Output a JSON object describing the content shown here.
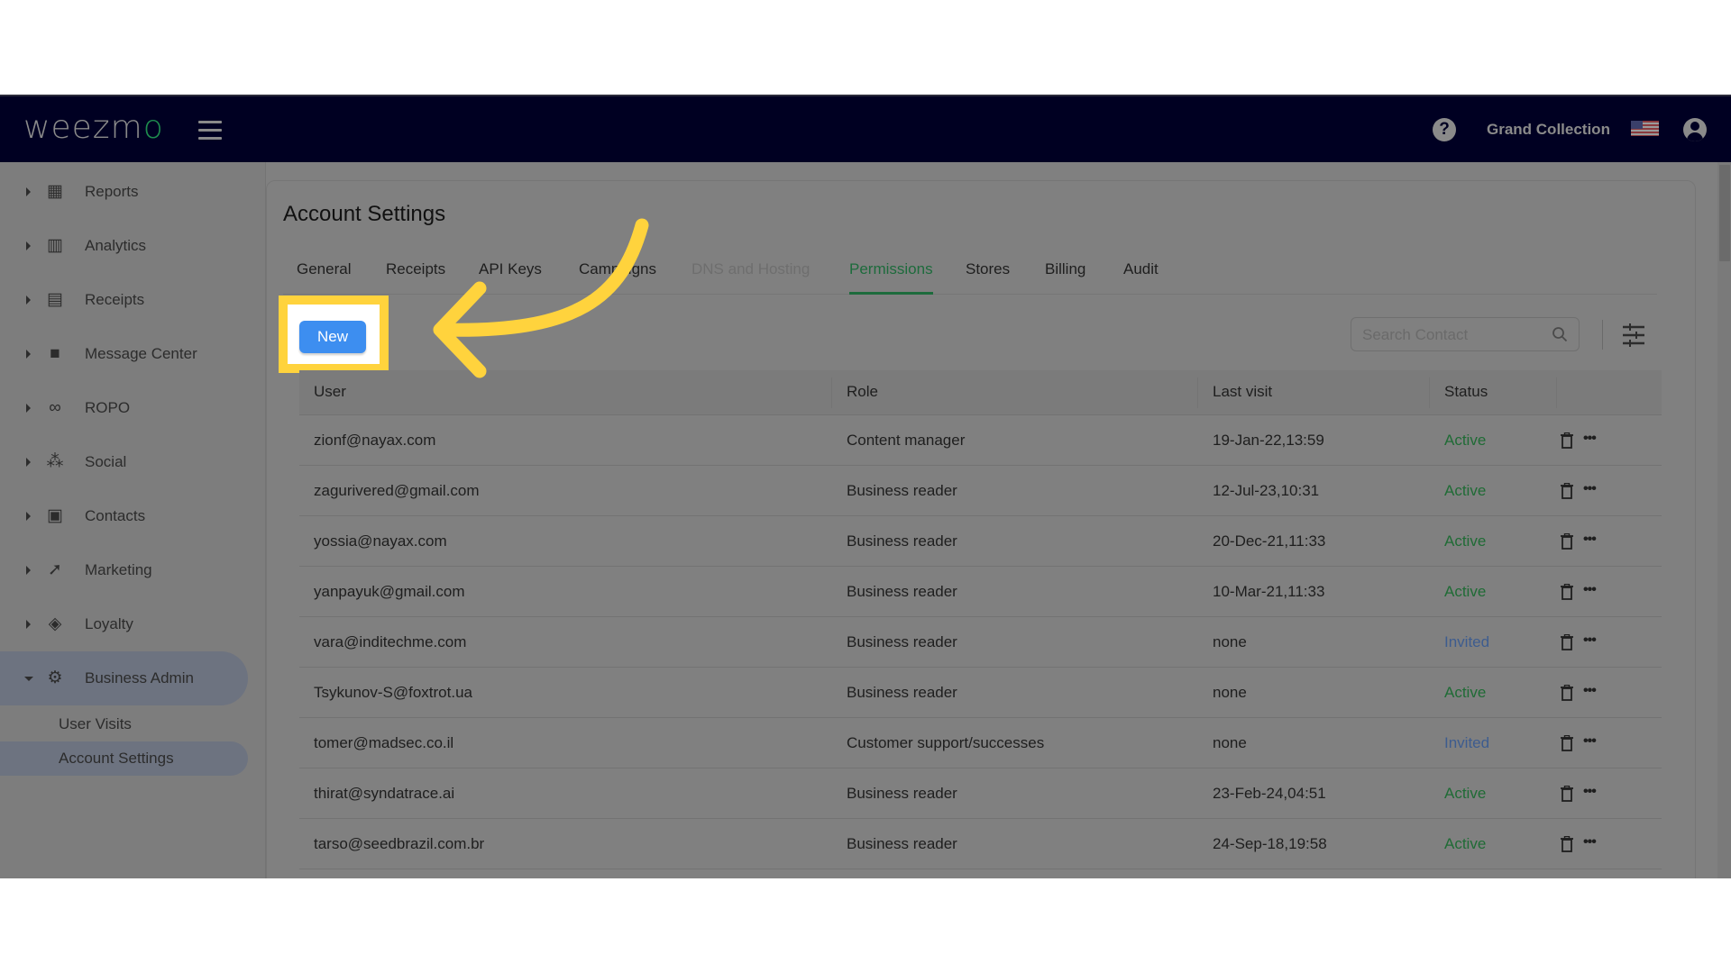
{
  "header": {
    "logo": "weezm",
    "logo_accent": "o",
    "account_name": "Grand Collection",
    "icons": [
      "menu-icon",
      "help-icon",
      "us-flag-icon",
      "user-account-icon"
    ]
  },
  "sidebar": {
    "items": [
      {
        "label": "Reports",
        "icon": "dashboard-icon",
        "glyph": "▦"
      },
      {
        "label": "Analytics",
        "icon": "bar-chart-icon",
        "glyph": "▥"
      },
      {
        "label": "Receipts",
        "icon": "receipt-icon",
        "glyph": "▤"
      },
      {
        "label": "Message Center",
        "icon": "chat-bubble-icon",
        "glyph": "■"
      },
      {
        "label": "ROPO",
        "icon": "infinity-icon",
        "glyph": "∞"
      },
      {
        "label": "Social",
        "icon": "people-group-icon",
        "glyph": "⁂"
      },
      {
        "label": "Contacts",
        "icon": "contact-card-icon",
        "glyph": "▣"
      },
      {
        "label": "Marketing",
        "icon": "party-popper-icon",
        "glyph": "➚"
      },
      {
        "label": "Loyalty",
        "icon": "tag-heart-icon",
        "glyph": "◈"
      },
      {
        "label": "Business Admin",
        "icon": "gear-icon",
        "glyph": "⚙"
      }
    ],
    "sub_items": [
      {
        "label": "User Visits"
      },
      {
        "label": "Account Settings"
      }
    ]
  },
  "page": {
    "title": "Account Settings",
    "tabs": [
      {
        "label": "General",
        "state": "normal"
      },
      {
        "label": "Receipts",
        "state": "normal"
      },
      {
        "label": "API Keys",
        "state": "normal"
      },
      {
        "label": "Campaigns",
        "state": "normal"
      },
      {
        "label": "DNS and Hosting",
        "state": "disabled"
      },
      {
        "label": "Permissions",
        "state": "active"
      },
      {
        "label": "Stores",
        "state": "normal"
      },
      {
        "label": "Billing",
        "state": "normal"
      },
      {
        "label": "Audit",
        "state": "normal"
      }
    ],
    "new_button": "New",
    "search": {
      "placeholder": "Search Contact",
      "value": ""
    }
  },
  "table": {
    "columns": [
      "User",
      "Role",
      "Last visit",
      "Status"
    ],
    "rows": [
      {
        "user": "zionf@nayax.com",
        "role": "Content manager",
        "last_visit": "19-Jan-22,13:59",
        "status": "Active"
      },
      {
        "user": "zagurivered@gmail.com",
        "role": "Business reader",
        "last_visit": "12-Jul-23,10:31",
        "status": "Active"
      },
      {
        "user": "yossia@nayax.com",
        "role": "Business reader",
        "last_visit": "20-Dec-21,11:33",
        "status": "Active"
      },
      {
        "user": "yanpayuk@gmail.com",
        "role": "Business reader",
        "last_visit": "10-Mar-21,11:33",
        "status": "Active"
      },
      {
        "user": "vara@inditechme.com",
        "role": "Business reader",
        "last_visit": "none",
        "status": "Invited"
      },
      {
        "user": "Tsykunov-S@foxtrot.ua",
        "role": "Business reader",
        "last_visit": "none",
        "status": "Active"
      },
      {
        "user": "tomer@madsec.co.il",
        "role": "Customer support/successes",
        "last_visit": "none",
        "status": "Invited"
      },
      {
        "user": "thirat@syndatrace.ai",
        "role": "Business reader",
        "last_visit": "23-Feb-24,04:51",
        "status": "Active"
      },
      {
        "user": "tarso@seedbrazil.com.br",
        "role": "Business reader",
        "last_visit": "24-Sep-18,19:58",
        "status": "Active"
      }
    ]
  },
  "colors": {
    "header_bg": "#000022",
    "primary_button": "#3d8ef0",
    "active_tab": "#1d6b3c",
    "status_active": "#1f6b35",
    "status_invited": "#3d5c8f",
    "annotation_highlight": "#ffd33d"
  }
}
